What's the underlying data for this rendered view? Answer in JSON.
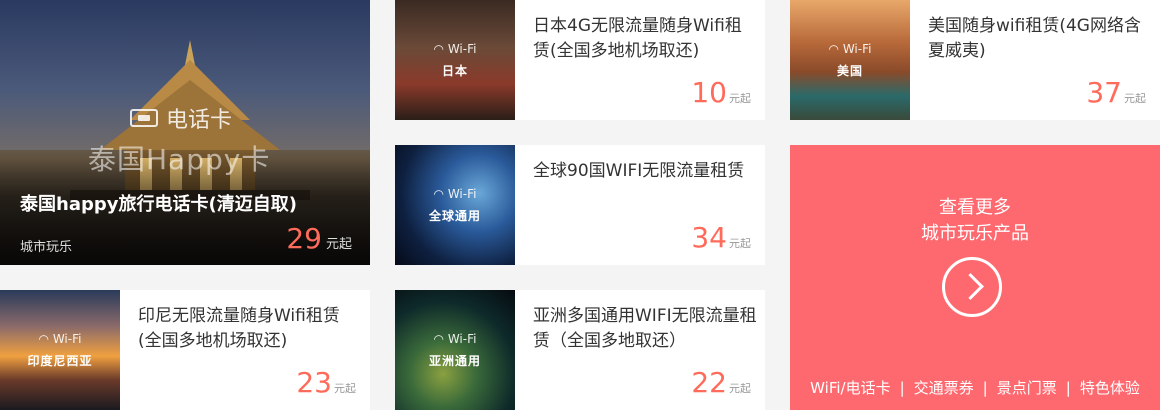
{
  "featured": {
    "badge_label": "电话卡",
    "watermark": "泰国Happy卡",
    "title": "泰国happy旅行电话卡(清迈自取)",
    "tag": "城市玩乐",
    "price": "29",
    "price_unit": "元起"
  },
  "products": [
    {
      "wifi_label": "Wi-Fi",
      "region": "日本",
      "title": "日本4G无限流量随身Wifi租赁(全国多地机场取还)",
      "price": "10",
      "price_unit": "元起"
    },
    {
      "wifi_label": "Wi-Fi",
      "region": "美国",
      "title": "美国随身wifi租赁(4G网络含夏威夷)",
      "price": "37",
      "price_unit": "元起"
    },
    {
      "wifi_label": "Wi-Fi",
      "region": "全球通用",
      "title": "全球90国WIFI无限流量租赁",
      "price": "34",
      "price_unit": "元起"
    },
    {
      "wifi_label": "Wi-Fi",
      "region": "印度尼西亚",
      "title": "印尼无限流量随身Wifi租赁(全国多地机场取还)",
      "price": "23",
      "price_unit": "元起"
    },
    {
      "wifi_label": "Wi-Fi",
      "region": "亚洲通用",
      "title": "亚洲多国通用WIFI无限流量租赁（全国多地取还）",
      "price": "22",
      "price_unit": "元起"
    }
  ],
  "more": {
    "line1": "查看更多",
    "line2": "城市玩乐产品",
    "links": [
      "WiFi/电话卡",
      "交通票券",
      "景点门票",
      "特色体验"
    ],
    "separator": "|"
  }
}
